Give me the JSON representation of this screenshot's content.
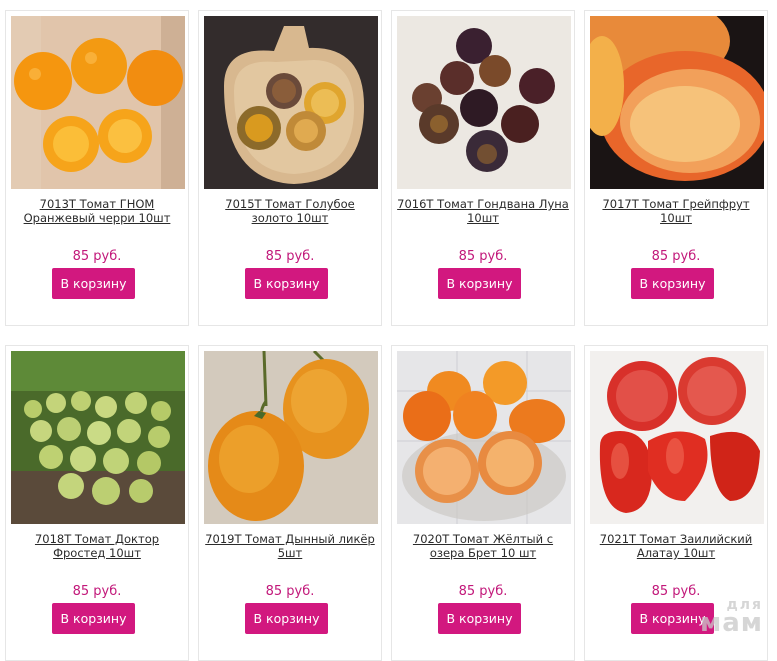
{
  "products": [
    {
      "title": "7013T Томат ГНОМ Оранжевый черри 10шт",
      "price": "85 руб.",
      "button": "В корзину",
      "image": "orange-cherry-tomatoes"
    },
    {
      "title": "7015T Томат Голубое золото 10шт",
      "price": "85 руб.",
      "button": "В корзину",
      "image": "blue-gold-tomatoes-on-board"
    },
    {
      "title": "7016T Томат Гондвана Луна 10шт",
      "price": "85 руб.",
      "button": "В корзину",
      "image": "dark-purple-cherry-tomatoes"
    },
    {
      "title": "7017T Томат Грейпфрут 10шт",
      "price": "85 руб.",
      "button": "В корзину",
      "image": "grapefruit-tomato-cut"
    },
    {
      "title": "7018T Томат Доктор Фростед 10шт",
      "price": "85 руб.",
      "button": "В корзину",
      "image": "green-cherry-tomatoes-cluster"
    },
    {
      "title": "7019T Томат Дынный ликёр 5шт",
      "price": "85 руб.",
      "button": "В корзину",
      "image": "orange-pear-tomatoes"
    },
    {
      "title": "7020T Томат Жёлтый с озера Брет 10 шт",
      "price": "85 руб.",
      "button": "В корзину",
      "image": "orange-heart-tomatoes"
    },
    {
      "title": "7021T Томат Заилийский Алатау 10шт",
      "price": "85 руб.",
      "button": "В корзину",
      "image": "red-heart-tomatoes"
    }
  ],
  "watermark": {
    "top": "для",
    "main": "мам"
  },
  "colors": {
    "accent": "#d2187f",
    "price": "#c2187a"
  }
}
